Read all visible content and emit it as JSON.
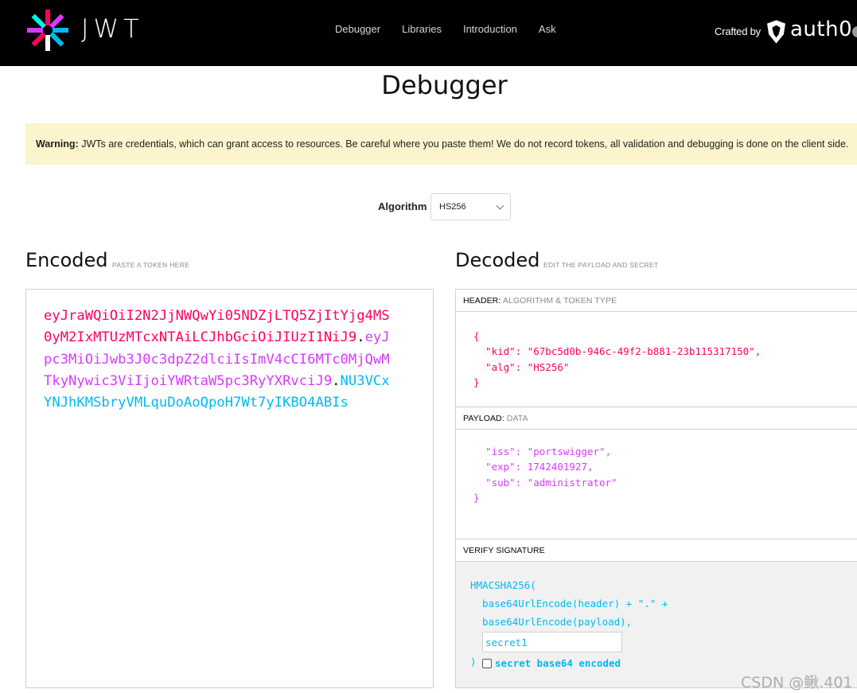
{
  "nav": {
    "logo_text": "JWT",
    "links": [
      "Debugger",
      "Libraries",
      "Introduction",
      "Ask"
    ],
    "crafted_by": "Crafted by",
    "brand": "auth0"
  },
  "page": {
    "title": "Debugger"
  },
  "warning": {
    "label": "Warning:",
    "text": "JWTs are credentials, which can grant access to resources. Be careful where you paste them! We do not record tokens, all validation and debugging is done on the client side."
  },
  "algorithm": {
    "label": "Algorithm",
    "selected": "HS256"
  },
  "encoded": {
    "title": "Encoded",
    "subtitle": "PASTE A TOKEN HERE",
    "header_part": "eyJraWQiOiI2N2JjNWQwYi05NDZjLTQ5ZjItYjg4MS0yM2IxMTUzMTcxNTAiLCJhbGciOiJIUzI1NiJ9",
    "payload_part": "eyJpc3MiOiJwb3J0c3dpZ2dlciIsImV4cCI6MTc0MjQwMTkyNywic3ViIjoiYWRtaW5pc3RyYXRvciJ9",
    "signature_part": "NU3VCxYNJhKMSbryVMLquDoAoQpoH7Wt7yIKBO4ABIs",
    "dot": "."
  },
  "decoded": {
    "title": "Decoded",
    "subtitle": "EDIT THE PAYLOAD AND SECRET",
    "header": {
      "label": "HEADER:",
      "sublabel": "ALGORITHM & TOKEN TYPE",
      "json": "{\n  \"kid\": \"67bc5d0b-946c-49f2-b881-23b115317150\",\n  \"alg\": \"HS256\"\n}"
    },
    "payload": {
      "label": "PAYLOAD:",
      "sublabel": "DATA",
      "json": "  \"iss\": \"portswigger\",\n  \"exp\": 1742401927,\n  \"sub\": \"administrator\"\n}"
    },
    "signature": {
      "label": "VERIFY SIGNATURE",
      "line1": "HMACSHA256(",
      "line2": "  base64UrlEncode(header) + \".\" +",
      "line3": "  base64UrlEncode(payload),",
      "secret_value": "secret1",
      "close": ")",
      "checkbox_label": "secret base64 encoded"
    }
  },
  "watermark": "CSDN @鳅.401",
  "colors": {
    "header": "#fb015b",
    "payload": "#d63aff",
    "signature": "#00b9f1",
    "warning_bg": "#fbf4cd"
  }
}
